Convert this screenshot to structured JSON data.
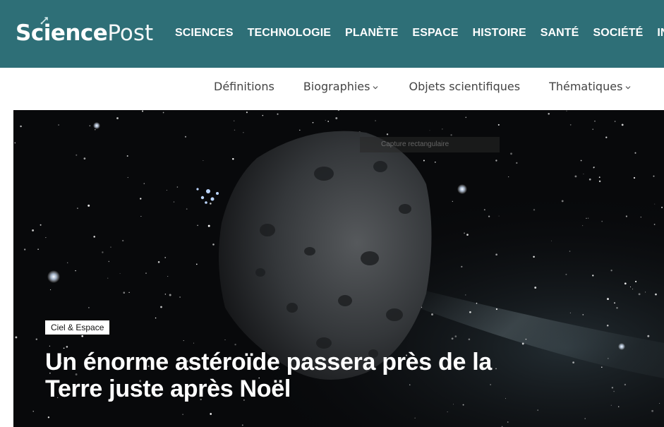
{
  "header": {
    "logo_bold": "Science",
    "logo_light": "Post",
    "bg_color": "#2e6f77",
    "nav": [
      {
        "label": "SCIENCES"
      },
      {
        "label": "TECHNOLOGIE"
      },
      {
        "label": "PLANÈTE"
      },
      {
        "label": "ESPACE"
      },
      {
        "label": "HISTOIRE"
      },
      {
        "label": "SANTÉ"
      },
      {
        "label": "SOCIÉTÉ"
      },
      {
        "label": "INSOLI"
      }
    ]
  },
  "subnav": {
    "items": [
      {
        "label": "Définitions",
        "dropdown": false
      },
      {
        "label": "Biographies",
        "dropdown": true
      },
      {
        "label": "Objets scientifiques",
        "dropdown": false
      },
      {
        "label": "Thématiques",
        "dropdown": true
      }
    ]
  },
  "hero": {
    "category": "Ciel & Espace",
    "title": "Un énorme astéroïde passera près de la Terre juste après Noël",
    "caption": "Capture rectangulaire"
  }
}
